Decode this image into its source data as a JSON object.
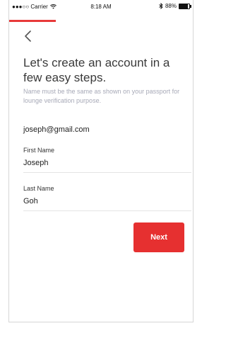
{
  "status_bar": {
    "carrier": "●●●○○ Carrier",
    "wifi_icon": "wifi-icon",
    "time": "8:18 AM",
    "bluetooth_icon": "bluetooth-icon",
    "battery_percent": "88%",
    "battery_level": 0.88
  },
  "progress": {
    "fraction": 0.25,
    "color": "#e83a3a"
  },
  "header": {
    "back_icon": "chevron-left-icon",
    "headline": "Let's create an account in a few easy steps.",
    "subtext": "Name must be the same as shown on your passport for lounge verification purpose."
  },
  "form": {
    "email": "joseph@gmail.com",
    "first_name_label": "First Name",
    "first_name_value": "Joseph",
    "last_name_label": "Last Name",
    "last_name_value": "Goh"
  },
  "actions": {
    "next_label": "Next",
    "next_color": "#e63030"
  }
}
